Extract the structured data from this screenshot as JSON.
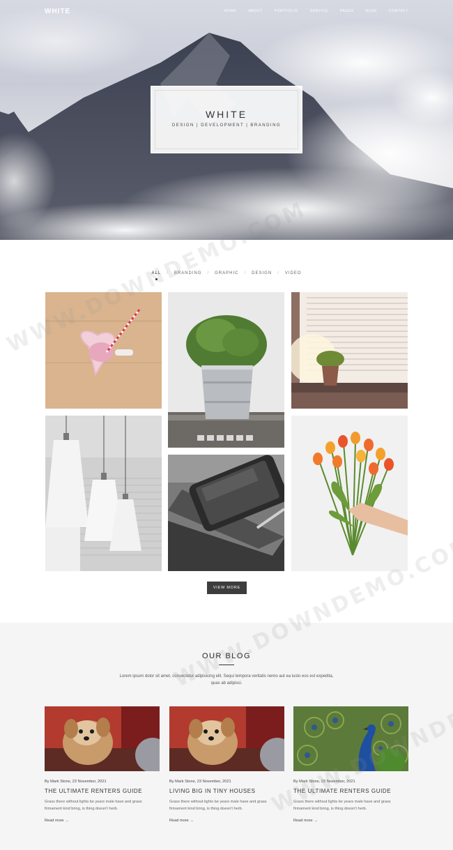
{
  "nav": {
    "logo": "WHITE",
    "items": [
      "HOME",
      "ABOUT",
      "PORTFOLIO",
      "SERVICE",
      "PAGES",
      "BLOG",
      "CONTACT"
    ]
  },
  "hero": {
    "title": "WHITE",
    "subtitle": "DESIGN | DEVELOPMENT | BRANDING"
  },
  "portfolio": {
    "filters": [
      "ALL",
      "BRANDING",
      "GRAPHIC",
      "DESIGN",
      "VIDEO"
    ],
    "active_filter": "ALL",
    "view_more": "VIEW MORE"
  },
  "blog": {
    "title": "OUR BLOG",
    "description": "Lorem ipsum dolor sit amet, consectetur adipisicing elit. Sequi tempora veritatis nemo aut ea iusto eos est expedita, quas ab adipisci.",
    "posts": [
      {
        "meta": "By Mark Stone, 23 November, 2021",
        "title": "THE ULTIMATE RENTERS GUIDE",
        "excerpt": "Grass there without lights be years male have and grass firmament kind bring, is thing doesn't herb.",
        "more": "Read more →"
      },
      {
        "meta": "By Mark Stone, 23 November, 2021",
        "title": "LIVING BIG IN TINY HOUSES",
        "excerpt": "Grass there without lights be years male have and grass firmament kind bring, is thing doesn't herb.",
        "more": "Read more →"
      },
      {
        "meta": "By Mark Stone, 23 November, 2021",
        "title": "THE ULTIMATE RENTERS GUIDE",
        "excerpt": "Grass there without lights be years male have and grass firmament kind bring, is thing doesn't herb.",
        "more": "Read more →"
      }
    ]
  },
  "watermark": "WWW.DOWNDEMO.COM",
  "colors": {
    "dark_button": "#3d3d3d",
    "blog_bg": "#f5f5f5"
  }
}
